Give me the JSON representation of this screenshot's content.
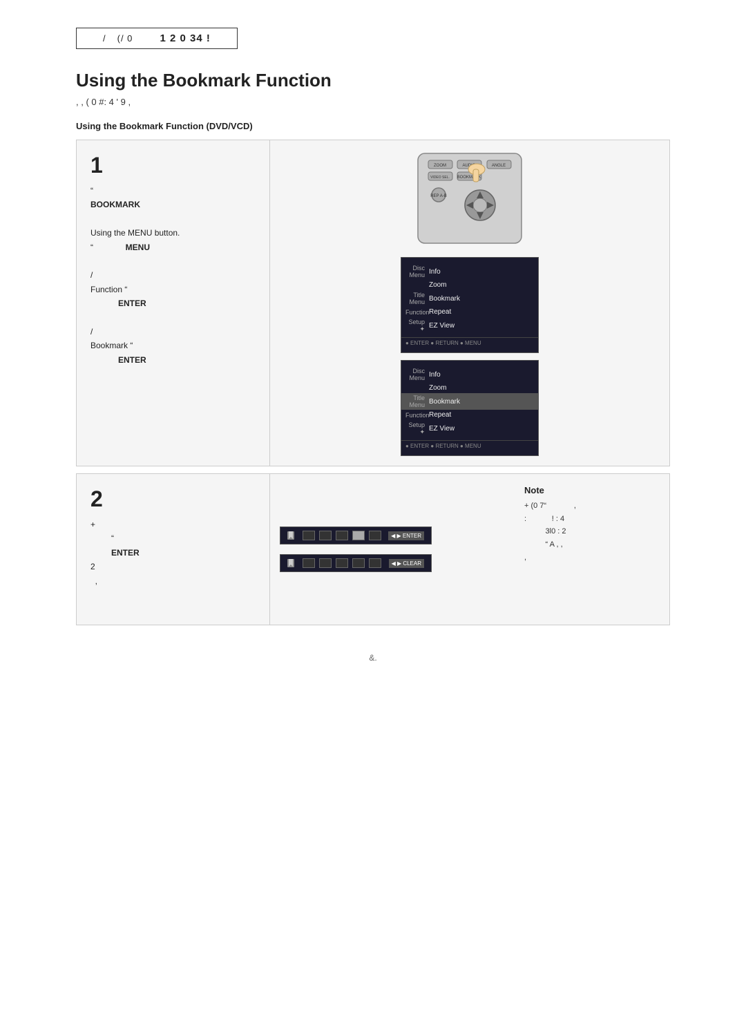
{
  "header": {
    "part1": "/",
    "part2": "(/ 0",
    "part3": "1 2 0 34 !"
  },
  "page": {
    "title": "Using the Bookmark Function",
    "subtitle": ",  ,         (  0 #:  4  '     9  ,",
    "section_label": "Using the Bookmark Function (DVD/VCD)"
  },
  "step1": {
    "number": "1",
    "lines": [
      "\"",
      "BOOKMARK",
      "",
      "Using the MENU button.",
      "\"              MENU",
      "",
      "/",
      "Function \"",
      "           ENTER",
      "",
      "/",
      "Bookmark \"",
      "           ENTER"
    ]
  },
  "menu1": {
    "items": [
      {
        "icon": "Disc Menu",
        "label": "Info",
        "highlighted": false
      },
      {
        "icon": "",
        "label": "Zoom",
        "highlighted": false
      },
      {
        "icon": "Title Menu",
        "label": "Bookmark",
        "highlighted": false
      },
      {
        "icon": "Function",
        "label": "Repeat",
        "highlighted": false
      },
      {
        "icon": "Setup",
        "label": "EZ View",
        "highlighted": false
      }
    ],
    "footer": "● ENTER  ● RETURN  ● MENU"
  },
  "menu2": {
    "items": [
      {
        "icon": "Disc Menu",
        "label": "Info",
        "highlighted": false
      },
      {
        "icon": "",
        "label": "Zoom",
        "highlighted": false
      },
      {
        "icon": "Title Menu",
        "label": "Bookmark",
        "highlighted": true
      },
      {
        "icon": "Function",
        "label": "Repeat",
        "highlighted": false
      },
      {
        "icon": "Setup",
        "label": "EZ View",
        "highlighted": false
      }
    ],
    "footer": "● ENTER  ● RETURN  ● MENU"
  },
  "step2": {
    "number": "2",
    "lines": [
      "+",
      "         \"",
      "         ENTER",
      "2",
      "  ,"
    ]
  },
  "note": {
    "title": "Note",
    "lines": [
      "+ (0  7\"                ,",
      ":           !  :  4",
      "          3l0 :  2",
      "          \"  A  ,  ,",
      ","
    ]
  },
  "footer": {
    "text": "&."
  },
  "bm_bar1": {
    "label": "◀ ▶ ENTER"
  },
  "bm_bar2": {
    "label": "◀ ▶ CLEAR"
  }
}
